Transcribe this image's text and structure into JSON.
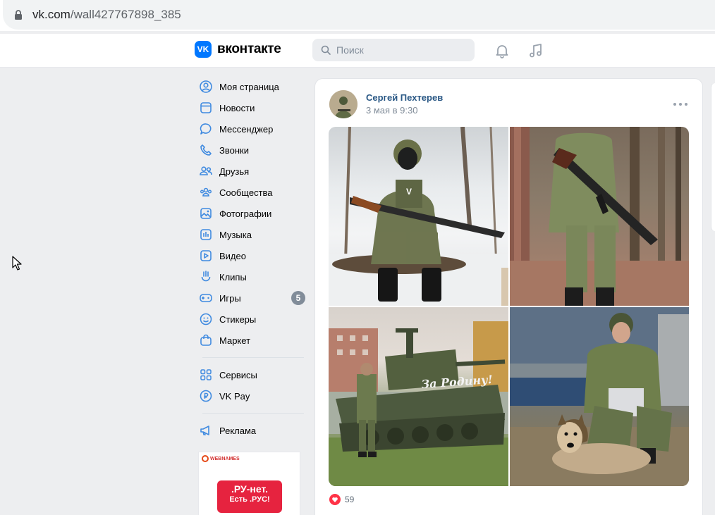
{
  "browser": {
    "url_domain": "vk.com",
    "url_path": "/wall427767898_385"
  },
  "header": {
    "logo_mark": "VK",
    "logo_text": "вконтакте",
    "search_placeholder": "Поиск"
  },
  "sidebar": {
    "items": [
      {
        "label": "Моя страница",
        "icon": "user-circle-icon"
      },
      {
        "label": "Новости",
        "icon": "news-icon"
      },
      {
        "label": "Мессенджер",
        "icon": "message-icon"
      },
      {
        "label": "Звонки",
        "icon": "phone-icon"
      },
      {
        "label": "Друзья",
        "icon": "friends-icon"
      },
      {
        "label": "Сообщества",
        "icon": "communities-icon"
      },
      {
        "label": "Фотографии",
        "icon": "photo-icon"
      },
      {
        "label": "Музыка",
        "icon": "music-icon"
      },
      {
        "label": "Видео",
        "icon": "video-icon"
      },
      {
        "label": "Клипы",
        "icon": "clips-icon"
      },
      {
        "label": "Игры",
        "icon": "games-icon",
        "badge": "5"
      },
      {
        "label": "Стикеры",
        "icon": "sticker-icon"
      },
      {
        "label": "Маркет",
        "icon": "market-icon"
      }
    ],
    "items2": [
      {
        "label": "Сервисы",
        "icon": "services-icon"
      },
      {
        "label": "VK Pay",
        "icon": "vkpay-icon"
      }
    ],
    "items3": [
      {
        "label": "Реклама",
        "icon": "megaphone-icon"
      }
    ]
  },
  "ad": {
    "brand": "WEBNAMES",
    "line1": ".РУ-нет.",
    "line2": "Есть .РУС!"
  },
  "post": {
    "author": "Сергей Пехтерев",
    "date": "3 мая в 9:30",
    "likes": "59",
    "tank_text": "За Родину!",
    "vest_mark": "V"
  },
  "colors": {
    "accent": "#0077ff",
    "link": "#2a5885",
    "icon": "#3f8ae0"
  }
}
